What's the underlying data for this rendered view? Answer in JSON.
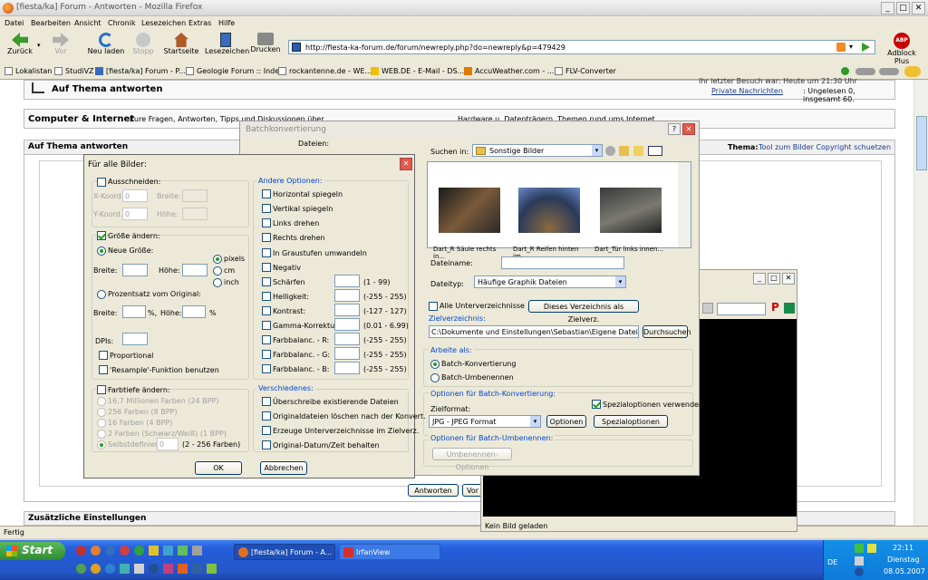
{
  "window": {
    "title": "[fiesta/ka] Forum - Antworten - Mozilla Firefox"
  },
  "menu": [
    "Datei",
    "Bearbeiten",
    "Ansicht",
    "Chronik",
    "Lesezeichen",
    "Extras",
    "Hilfe"
  ],
  "nav": {
    "back": "Zurück",
    "forward": "Vor",
    "reload": "Neu laden",
    "stop": "Stopp",
    "home": "Startseite",
    "bookmarks": "Lesezeichen",
    "print": "Drucken",
    "url": "http://fiesta-ka-forum.de/forum/newreply.php?do=newreply&p=479429",
    "adblock": "Adblock Plus",
    "adblock_badge": "ABP"
  },
  "bookmarks": [
    "Lokalistan",
    "StudiVZ",
    "[fiesta/ka] Forum - P...",
    "Geologie Forum :: Index",
    "rockantenne.de - WE...",
    "WEB.DE - E-Mail - DS...",
    "AccuWeather.com - ...",
    "FLV-Converter"
  ],
  "forum": {
    "heading": "Auf Thema antworten",
    "login_line": "Ihr letzter Besuch war: Heute um 21:30 Uhr",
    "pm_link": "Private Nachrichten",
    "pm_text": ": Ungelesen 0, insgesamt 60.",
    "category": "Computer & Internet",
    "category_desc": "Eure Fragen, Antworten, Tipps und Diskussionen über",
    "category_desc2": "Hardware u. Datenträgern. Themen rund ums Internet",
    "reply_title": "Auf Thema antworten",
    "thema_label": "Thema:",
    "thema_link": "Tool zum Bilder Copyright schuetzen",
    "reply_btn": "Antworten",
    "preview_btn": "Vor",
    "extra": "Zusätzliche Einstellungen"
  },
  "status": {
    "text": "Fertig"
  },
  "batch": {
    "title": "Batchkonvertierung",
    "files_label": "Dateien:",
    "lookin": "Suchen in:",
    "folder": "Sonstige Bilder",
    "thumbs": [
      "Dart_R Säule rechts in...",
      "Dart_R Reifen hinten im...",
      "Dart_Tür links innen..."
    ],
    "filename_label": "Dateiname:",
    "filetype_label": "Dateityp:",
    "filetype": "Häufige Graphik Dateien",
    "subdirs": "Alle Unterverzeichnisse",
    "as_target": "Dieses Verzeichnis als Zielverz.",
    "target_label": "Zielverzeichnis:",
    "target_path": "C:\\Dokumente und Einstellungen\\Sebastian\\Eigene Dateien\\Eigen",
    "browse": "Durchsuchen",
    "work_label": "Arbeite als:",
    "mode1": "Batch-Konvertierung",
    "mode2": "Batch-Umbenennen",
    "opts_label": "Optionen für Batch-Konvertierung:",
    "special_chk": "Spezialoptionen verwenden",
    "format_label": "Zielformat:",
    "format": "JPG - JPEG Format",
    "options_btn": "Optionen",
    "special_btn": "Spezialoptionen",
    "rename_label": "Optionen für Batch-Umbenennen:",
    "rename_btn": "Umbenennen-Optionen"
  },
  "irfan": {
    "status": "Kein Bild geladen"
  },
  "dialog": {
    "title": "Für alle Bilder:",
    "crop": "Ausschneiden:",
    "x": "X-Koord.:",
    "y": "Y-Koord.:",
    "xval": "0",
    "yval": "0",
    "width": "Breite:",
    "height": "Höhe:",
    "resize": "Größe ändern:",
    "newsize": "Neue Größe:",
    "w2": "Breite:",
    "h2": "Höhe:",
    "units": [
      "pixels",
      "cm",
      "inch"
    ],
    "percent": "Prozentsatz vom Original:",
    "w3": "Breite:",
    "h3": "Höhe:",
    "pct1": "%,",
    "pct2": "%",
    "dpi": "DPIs:",
    "proportional": "Proportional",
    "resample": "'Resample'-Funktion benutzen",
    "colors": "Farbtiefe ändern:",
    "color_opts": [
      "16,7 Millionen Farben (24 BPP)",
      "256 Farben (8 BPP)",
      "16 Farben (4 BPP)",
      "2 Farben (Schwarz/Weiß) (1 BPP)",
      "Selbstdefiniert:"
    ],
    "custom_val": "0",
    "custom_range": "(2 - 256 Farben)",
    "other": "Andere Optionen:",
    "other_opts": [
      "Horizontal spiegeln",
      "Vertikal spiegeln",
      "Links drehen",
      "Rechts drehen",
      "In Graustufen umwandeln",
      "Negativ"
    ],
    "adjust": [
      {
        "l": "Schärfen",
        "r": "(1  -  99)"
      },
      {
        "l": "Helligkeit:",
        "r": "(-255  -  255)"
      },
      {
        "l": "Kontrast:",
        "r": "(-127  -  127)"
      },
      {
        "l": "Gamma-Korrektur:",
        "r": "(0.01  -  6.99)"
      },
      {
        "l": "Farbbalanc. - R:",
        "r": "(-255  -  255)"
      },
      {
        "l": "Farbbalanc. - G:",
        "r": "(-255  -  255)"
      },
      {
        "l": "Farbbalanc. - B:",
        "r": "(-255  -  255)"
      }
    ],
    "misc": "Verschiedenes:",
    "misc_opts": [
      "Überschreibe existierende Dateien",
      "Originaldateien löschen nach der Konvert.",
      "Erzeuge Unterverzeichnisse im Zielverz.",
      "Original-Datum/Zeit behalten"
    ],
    "ok": "OK",
    "cancel": "Abbrechen"
  },
  "taskbar": {
    "start": "Start",
    "tasks": [
      "[fiesta/ka] Forum - A...",
      "IrfanView"
    ],
    "lang": "DE",
    "time": "22:11",
    "day": "Dienstag",
    "date": "08.05.2007"
  },
  "colors": {
    "xp_blue": "#0a5fd8",
    "start_green": "#3c9a3c",
    "forum_heading": "#000000"
  }
}
